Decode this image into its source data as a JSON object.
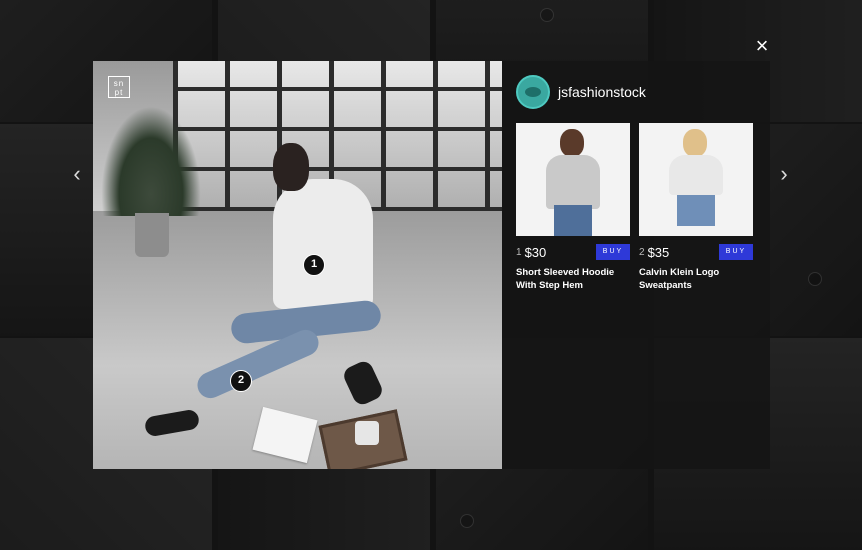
{
  "close_icon": "×",
  "nav": {
    "prev_icon": "‹",
    "next_icon": "›"
  },
  "photo": {
    "brand_logo": "sn\npt",
    "markers": [
      "1",
      "2"
    ]
  },
  "account": {
    "username": "jsfashionstock"
  },
  "products": [
    {
      "index": "1",
      "price": "$30",
      "buy_label": "BUY",
      "name": "Short Sleeved Hoodie With Step Hem"
    },
    {
      "index": "2",
      "price": "$35",
      "buy_label": "BUY",
      "name": "Calvin Klein Logo Sweatpants"
    }
  ],
  "colors": {
    "buy_button": "#2e39d8",
    "avatar": "#3aa8a0"
  }
}
